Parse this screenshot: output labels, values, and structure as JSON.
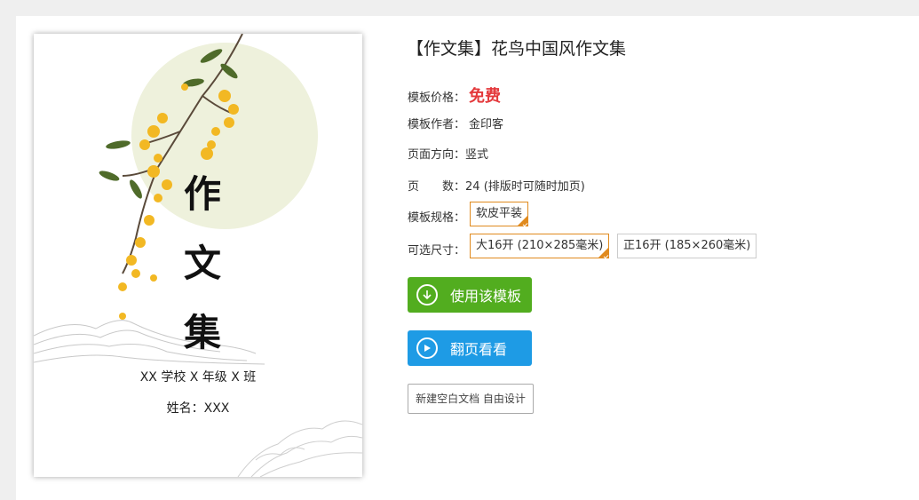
{
  "cover": {
    "title_chars": [
      "作",
      "文",
      "集"
    ],
    "school_line": "XX 学校 X 年级 X 班",
    "name_line": "姓名：XXX"
  },
  "info": {
    "title": "【作文集】花鸟中国风作文集",
    "price_label": "模板价格：",
    "price_value": "免费",
    "author_label": "模板作者：",
    "author_value": "金印客",
    "orientation_label": "页面方向：",
    "orientation_value": "竖式",
    "pages_label": "页　　数：",
    "pages_value": "24 (排版时可随时加页)",
    "spec_label": "模板规格：",
    "spec_options": [
      "软皮平装"
    ],
    "size_label": "可选尺寸：",
    "size_options": [
      "大16开 (210×285毫米)",
      "正16开 (185×260毫米)"
    ]
  },
  "actions": {
    "use_template": "使用该模板",
    "flip_view": "翻页看看",
    "new_blank": "新建空白文档 自由设计"
  },
  "colors": {
    "price": "#e4393c",
    "selected_border": "#e08a1e",
    "use_button": "#52ad1f",
    "flip_button": "#1e9be5",
    "moon": "#eef1dc"
  }
}
